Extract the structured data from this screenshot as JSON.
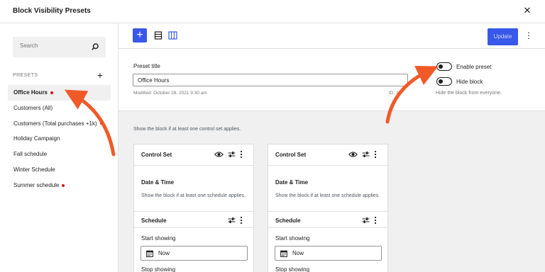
{
  "modal": {
    "title": "Block Visibility Presets",
    "close_glyph": "✕"
  },
  "sidebar": {
    "search_placeholder": "Search",
    "presets_heading": "PRESETS",
    "add_glyph": "+",
    "items": [
      {
        "label": "Office Hours",
        "active": true,
        "unsaved": true
      },
      {
        "label": "Customers (All)",
        "active": false,
        "unsaved": false
      },
      {
        "label": "Customers (Total purchases +1k)",
        "active": false,
        "unsaved": true
      },
      {
        "label": "Holiday Campaign",
        "active": false,
        "unsaved": false
      },
      {
        "label": "Fall schedule",
        "active": false,
        "unsaved": false
      },
      {
        "label": "Winter Schedule",
        "active": false,
        "unsaved": false
      },
      {
        "label": "Summer schedule",
        "active": false,
        "unsaved": true
      }
    ]
  },
  "toolbar": {
    "add_glyph": "+",
    "update_label": "Update",
    "more_glyph": "⋮"
  },
  "settings": {
    "preset_title_label": "Preset title",
    "preset_title_value": "Office Hours",
    "modified_text": "Modified: October 28, 2021 9:30 am",
    "id_text": "ID: 12",
    "enable_preset_label": "Enable preset",
    "enable_preset_on": false,
    "hide_block_label": "Hide block",
    "hide_block_on": false,
    "hide_block_help": "Hide the block from everyone."
  },
  "canvas": {
    "help_text": "Show the block if at least one control set applies.",
    "cards": [
      {
        "title": "Control Set",
        "section_title": "Date & Time",
        "section_help": "Show the block if at least one schedule applies.",
        "schedule_label": "Schedule",
        "start_label": "Start showing",
        "start_value": "Now",
        "stop_label": "Stop showing"
      },
      {
        "title": "Control Set",
        "section_title": "Date & Time",
        "section_help": "Show the block if at least one schedule applies.",
        "schedule_label": "Schedule",
        "start_label": "Start showing",
        "start_value": "Now",
        "stop_label": "Stop showing"
      }
    ]
  },
  "colors": {
    "accent": "#3858e9",
    "unsaved_dot": "#cc1818",
    "annotation_arrow": "#f05a28",
    "canvas_bg": "#f0f0f0"
  },
  "icons": {
    "search": "search-icon",
    "list_view": "list-view-icon",
    "columns_view": "columns-icon",
    "visibility": "eye-icon",
    "settings": "sliders-icon",
    "calendar": "calendar-icon"
  }
}
